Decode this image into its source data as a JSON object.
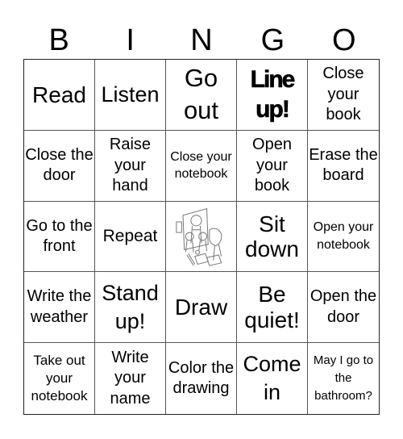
{
  "header": {
    "letters": [
      "B",
      "I",
      "N",
      "G",
      "O"
    ]
  },
  "cells": [
    "Read",
    "Listen",
    "Go out",
    "Line up!",
    "Close your book",
    "Close the door",
    "Raise your hand",
    "Close your notebook",
    "Open your book",
    "Erase the board",
    "Go to the front",
    "Repeat",
    "",
    "Sit down",
    "Open your notebook",
    "Write the weather",
    "Stand up!",
    "Draw",
    "Be quiet!",
    "Open the door",
    "Take out your notebook",
    "Write your name",
    "Color the drawing",
    "Come in",
    "May I go to the bathroom?"
  ],
  "free_space": {
    "icon": "classroom-drawing-icon"
  }
}
